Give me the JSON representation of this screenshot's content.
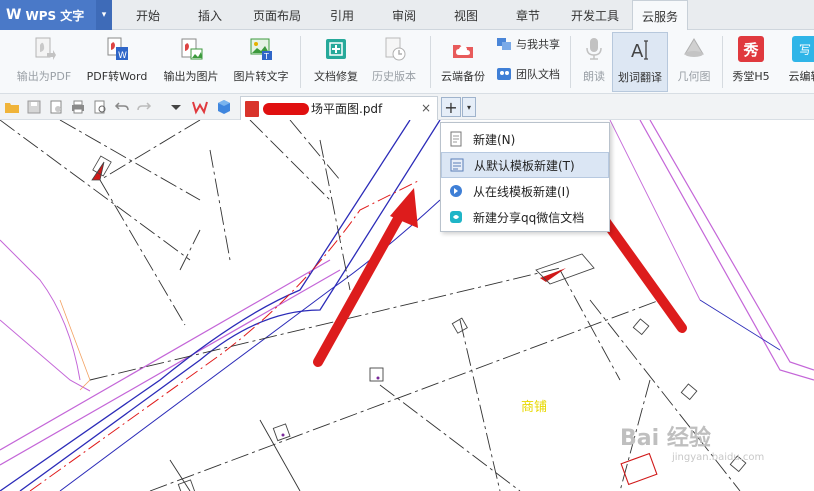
{
  "app": {
    "logo": "W",
    "name": "WPS 文字",
    "dropdown_glyph": "▾"
  },
  "menu_tabs": [
    "开始",
    "插入",
    "页面布局",
    "引用",
    "审阅",
    "视图",
    "章节",
    "开发工具",
    "云服务"
  ],
  "active_tab": "云服务",
  "ribbon": {
    "buttons": [
      {
        "label": "输出为PDF",
        "icon": "export-pdf-icon",
        "disabled": true
      },
      {
        "label": "PDF转Word",
        "icon": "pdf-to-word-icon",
        "disabled": false
      },
      {
        "label": "输出为图片",
        "icon": "export-image-icon",
        "disabled": false
      },
      {
        "label": "图片转文字",
        "icon": "image-to-text-icon",
        "disabled": false
      },
      {
        "label": "文档修复",
        "icon": "doc-repair-icon",
        "disabled": false
      },
      {
        "label": "历史版本",
        "icon": "history-icon",
        "disabled": true
      },
      {
        "label": "云端备份",
        "icon": "cloud-backup-icon",
        "disabled": false
      },
      {
        "label": "朗读",
        "icon": "microphone-icon",
        "disabled": true
      },
      {
        "label": "划词翻译",
        "icon": "translate-icon",
        "disabled": false,
        "pressed": true
      },
      {
        "label": "几何图",
        "icon": "geometry-icon",
        "disabled": true
      },
      {
        "label": "秀堂H5",
        "icon": "xiutang-icon",
        "disabled": false
      },
      {
        "label": "云编辑",
        "icon": "cloud-edit-icon",
        "disabled": false
      }
    ],
    "small_buttons": [
      {
        "label": "与我共享",
        "icon": "share-icon"
      },
      {
        "label": "团队文档",
        "icon": "team-doc-icon"
      }
    ],
    "xiutang_glyph": "秀",
    "cloud_edit_glyph": "写"
  },
  "document_tab": {
    "name": "场平面图.pdf",
    "close": "×"
  },
  "new_tab": {
    "plus": "+",
    "drop": "▾"
  },
  "dropdown": {
    "items": [
      {
        "label": "新建(N)",
        "icon": "new-doc-icon"
      },
      {
        "label": "从默认模板新建(T)",
        "icon": "default-template-icon",
        "highlighted": true
      },
      {
        "label": "从在线模板新建(I)",
        "icon": "online-template-icon"
      },
      {
        "label": "新建分享qq微信文档",
        "icon": "share-qq-wechat-doc-icon"
      }
    ]
  },
  "canvas": {
    "shop_label": "商铺"
  },
  "watermark": {
    "main": "Bai 经验",
    "sub": "jingyan.baidu.com"
  },
  "colors": {
    "menubar_bg": "#e9ecef",
    "app_button": "#4a79c8",
    "ribbon_bg": "#f7f9fb",
    "arrow_red": "#dd1c1c",
    "road_blue": "#2b2bb8",
    "road_purple": "#c466d8",
    "dash_red": "#e01a1a"
  }
}
